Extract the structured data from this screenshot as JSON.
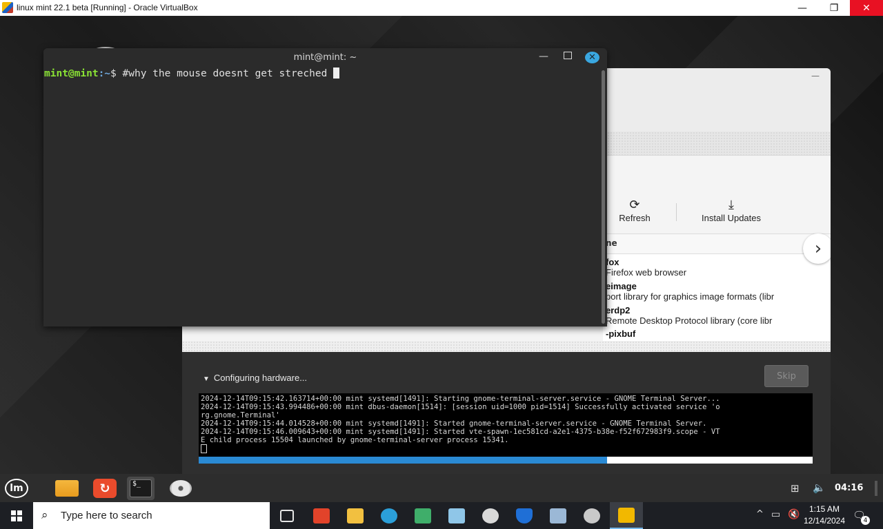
{
  "host_window": {
    "title": "linux mint 22.1 beta [Running] - Oracle VirtualBox",
    "minimize": "—",
    "restore": "❐",
    "close": "✕"
  },
  "terminal": {
    "title": "mint@mint: ~",
    "prompt_user": "mint@mint",
    "prompt_path": ":~",
    "prompt_symbol": "$ ",
    "command": "#why the mouse doesnt get streched ",
    "minimize": "—",
    "close": "✕"
  },
  "update_manager": {
    "minimize": "—",
    "toolbar": {
      "refresh_icon": "⟳",
      "refresh_label": "Refresh",
      "install_icon": "⤓",
      "install_label": "Install Updates"
    },
    "column_header": "ne",
    "next_arrow": "›",
    "rows": [
      {
        "name": "fox",
        "desc": "Firefox web browser"
      },
      {
        "name": "eimage",
        "desc": "port library for graphics image formats (libr"
      },
      {
        "name": "erdp2",
        "desc": "Remote Desktop Protocol library (core libr"
      },
      {
        "name": "-pixbuf",
        "desc": ""
      }
    ]
  },
  "installer": {
    "status": "Configuring hardware...",
    "skip_label": "Skip",
    "log_lines": [
      "2024-12-14T09:15:42.163714+00:00 mint systemd[1491]: Starting gnome-terminal-server.service - GNOME Terminal Server...",
      "2024-12-14T09:15:43.994486+00:00 mint dbus-daemon[1514]: [session uid=1000 pid=1514] Successfully activated service 'o",
      "rg.gnome.Terminal'",
      "2024-12-14T09:15:44.014528+00:00 mint systemd[1491]: Started gnome-terminal-server.service - GNOME Terminal Server.",
      "2024-12-14T09:15:46.009643+00:00 mint systemd[1491]: Started vte-spawn-1ec581cd-a2e1-4375-b38e-f52f672983f9.scope - VT",
      "E child process 15504 launched by gnome-terminal-server process 15341."
    ],
    "progress_percent": 66.5,
    "progress_color": "#2a8ad4"
  },
  "guest_panel": {
    "menu_label": "lm",
    "clock": "04:16",
    "network_icon": "⊞",
    "volume_icon": "🔈"
  },
  "windows_taskbar": {
    "search_placeholder": "Type here to search",
    "search_icon": "⌕",
    "tray_chevron": "^",
    "tray_network": "▭",
    "tray_sound": "🔇",
    "time": "1:15 AM",
    "date": "12/14/2024",
    "notification_icon": "🗨",
    "notification_count": "4",
    "apps": [
      {
        "name": "task-view",
        "color": "#e6e6e6"
      },
      {
        "name": "gitlab",
        "color": "#e2432a"
      },
      {
        "name": "file-explorer",
        "color": "#f2c040"
      },
      {
        "name": "edge",
        "color": "#2b9fd9"
      },
      {
        "name": "visual-studio",
        "color": "#3fae6a"
      },
      {
        "name": "notepad",
        "color": "#8fc6e8"
      },
      {
        "name": "ball-app",
        "color": "#d9d9d9"
      },
      {
        "name": "defender",
        "color": "#1f6fd6"
      },
      {
        "name": "remote-desktop",
        "color": "#9bb8d6"
      },
      {
        "name": "paint",
        "color": "#c9c9c9"
      },
      {
        "name": "virtualbox",
        "color": "#f2b800"
      }
    ]
  },
  "colors": {
    "prompt_user": "#8ae234",
    "prompt_path": "#6fa8dc",
    "accent_close": "#3aa7e0",
    "host_close": "#e81123"
  }
}
